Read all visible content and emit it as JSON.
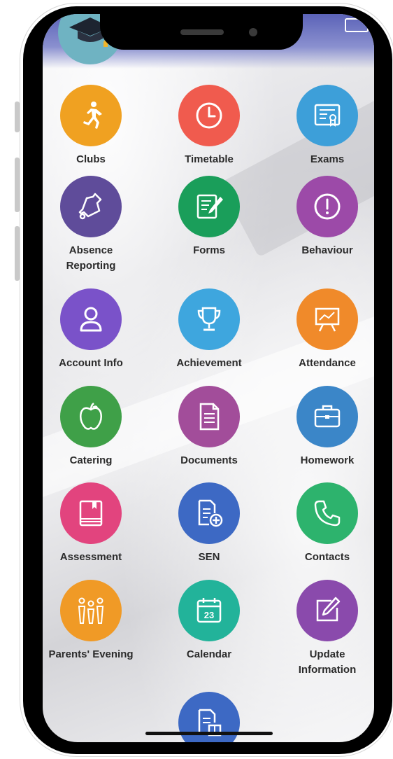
{
  "tiles": [
    {
      "label": "Clubs",
      "icon": "running-person-icon",
      "color": "#f0a121"
    },
    {
      "label": "Timetable",
      "icon": "clock-icon",
      "color": "#f05b4e"
    },
    {
      "label": "Exams",
      "icon": "certificate-icon",
      "color": "#3d9fd9"
    },
    {
      "label": "Absence Reporting",
      "icon": "bell-icon",
      "color": "#5f4c9a"
    },
    {
      "label": "Forms",
      "icon": "form-pen-icon",
      "color": "#1a9e5a"
    },
    {
      "label": "Behaviour",
      "icon": "exclamation-icon",
      "color": "#9c4aa8"
    },
    {
      "label": "Account Info",
      "icon": "user-icon",
      "color": "#7a52c9"
    },
    {
      "label": "Achievement",
      "icon": "trophy-icon",
      "color": "#3ea6de"
    },
    {
      "label": "Attendance",
      "icon": "presentation-chart-icon",
      "color": "#f08a2a"
    },
    {
      "label": "Catering",
      "icon": "apple-icon",
      "color": "#3fa048"
    },
    {
      "label": "Documents",
      "icon": "document-icon",
      "color": "#a24d9a"
    },
    {
      "label": "Homework",
      "icon": "briefcase-icon",
      "color": "#3b86c8"
    },
    {
      "label": "Assessment",
      "icon": "book-icon",
      "color": "#e2447e"
    },
    {
      "label": "SEN",
      "icon": "document-plus-icon",
      "color": "#3d69c4"
    },
    {
      "label": "Contacts",
      "icon": "phone-icon",
      "color": "#2db36d"
    },
    {
      "label": "Parents' Evening",
      "icon": "people-icon",
      "color": "#f09a26"
    },
    {
      "label": "Calendar",
      "icon": "calendar-icon",
      "color": "#22b39a"
    },
    {
      "label": "Update Information",
      "icon": "edit-icon",
      "color": "#8a4aac"
    },
    {
      "label": "",
      "icon": "documents-stack-icon",
      "color": "#3d69c4"
    }
  ],
  "calendar": {
    "day": "23"
  }
}
